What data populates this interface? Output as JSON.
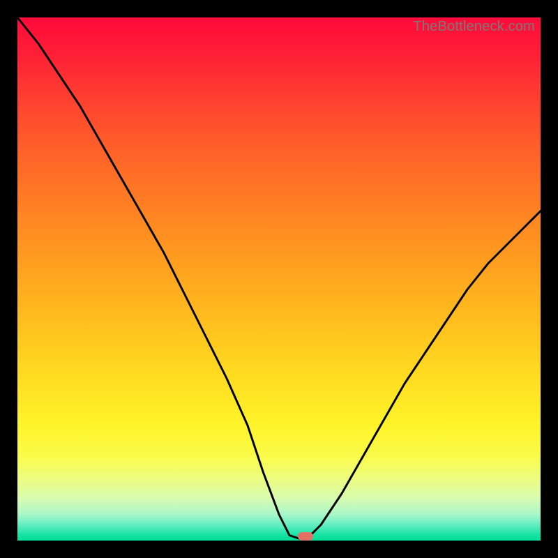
{
  "watermark": "TheBottleneck.com",
  "colors": {
    "frame": "#000000",
    "curve": "#000000",
    "marker": "#e17066",
    "watermark": "#7a7a7a"
  },
  "chart_data": {
    "type": "line",
    "title": "",
    "xlabel": "",
    "ylabel": "",
    "xlim": [
      0,
      100
    ],
    "ylim": [
      0,
      100
    ],
    "grid": false,
    "legend": false,
    "series": [
      {
        "name": "bottleneck-curve",
        "x": [
          0,
          4,
          8,
          12,
          16,
          20,
          24,
          28,
          32,
          36,
          40,
          44,
          47,
          50,
          52,
          55,
          58,
          62,
          66,
          70,
          74,
          78,
          82,
          86,
          90,
          94,
          98,
          100
        ],
        "values": [
          100,
          95,
          89,
          83,
          76,
          69,
          62,
          55,
          47,
          39,
          31,
          22,
          13,
          5,
          1,
          0,
          3,
          9,
          16,
          23,
          30,
          36,
          42,
          48,
          53,
          57,
          61,
          63
        ]
      }
    ],
    "annotations": [
      {
        "name": "optimal-marker",
        "x": 55,
        "y": 0
      }
    ],
    "background_gradient": {
      "top": "#ff0a3a",
      "mid": "#ffe021",
      "bottom": "#00dd93"
    }
  }
}
